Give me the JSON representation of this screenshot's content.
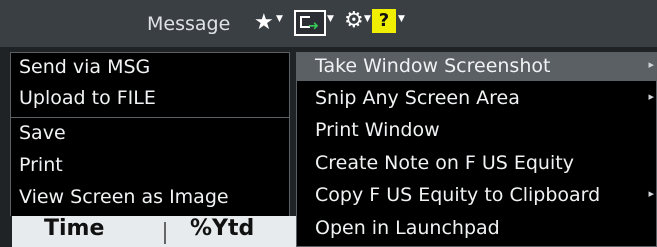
{
  "toolbar": {
    "title": "Message",
    "star_icon": "star-icon",
    "capture_icon": "screen-capture-icon",
    "settings_icon": "gear-icon",
    "help_label": "?",
    "help_color": "#f1ef00"
  },
  "left_menu": {
    "items": [
      "Send via MSG",
      "Upload to FILE",
      "Save",
      "Print",
      "View Screen as Image"
    ]
  },
  "right_menu": {
    "items": [
      {
        "label": "Take Window Screenshot",
        "has_submenu": true,
        "active": true
      },
      {
        "label": "Snip Any Screen Area",
        "has_submenu": true,
        "active": false
      },
      {
        "label": "Print Window",
        "has_submenu": false,
        "active": false
      },
      {
        "label": "Create Note on F US Equity",
        "has_submenu": false,
        "active": false
      },
      {
        "label": "Copy F US Equity to Clipboard",
        "has_submenu": true,
        "active": false
      },
      {
        "label": "Open in Launchpad",
        "has_submenu": false,
        "active": false
      }
    ]
  },
  "background_table": {
    "headers": [
      "Time",
      "%Ytd"
    ]
  }
}
